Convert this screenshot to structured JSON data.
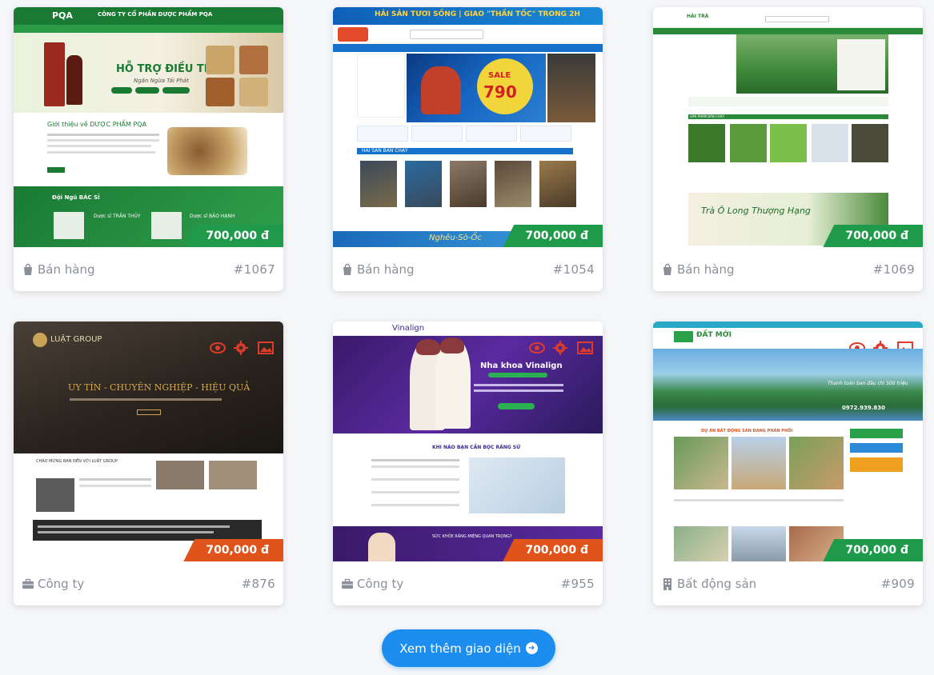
{
  "cards": [
    {
      "price": "700,000 đ",
      "category": "Bán hàng",
      "code": "#1067",
      "thumb": {
        "company": "CÔNG TY CỔ PHẦN DƯỢC PHẨM PQA",
        "brand": "PQA",
        "headline": "HỖ TRỢ ĐIỀU TRỊ",
        "sub": "Ngăn Ngừa Tái Phát",
        "intro": "Giới thiệu về DƯỢC PHẨM PQA",
        "team": "Đội Ngũ BÁC SĨ",
        "doctor1": "Dược sĩ TRẦN THỦY",
        "doctor2": "Dược sĩ BẢO HẠNH"
      }
    },
    {
      "price": "700,000 đ",
      "category": "Bán hàng",
      "code": "#1054",
      "thumb": {
        "banner": "HẢI SẢN TƯƠI SỐNG | GIAO \"THẦN TỐC\" TRONG 2H",
        "sale": "SALE",
        "sale_price": "790",
        "section": "HẢI SẢN BÁN CHẠY",
        "bottom": "Nghêu-Sò-Ốc"
      }
    },
    {
      "price": "700,000 đ",
      "category": "Bán hàng",
      "code": "#1069",
      "thumb": {
        "brand": "HẢI TRÀ",
        "section": "SẢN PHẨM BÁN CHẠY",
        "promo": "Trà Ô Long Thượng Hạng"
      }
    },
    {
      "price": "700,000 đ",
      "category": "Công ty",
      "code": "#876",
      "thumb": {
        "brand": "LUẬT GROUP",
        "headline": "UY TÍN - CHUYÊN NGHIỆP - HIỆU QUẢ",
        "welcome": "CHÀO MỪNG BẠN ĐẾN VỚI LUẬT GROUP"
      }
    },
    {
      "price": "700,000 đ",
      "category": "Công ty",
      "code": "#955",
      "thumb": {
        "brand": "Vinalign",
        "headline": "Nha khoa Vinalign",
        "question": "KHI NÀO BẠN CẦN BỌC RĂNG SỨ",
        "question2": "SỨC KHỎE RĂNG MIỆNG QUAN TRỌNG?"
      }
    },
    {
      "price": "700,000 đ",
      "category": "Bất động sản",
      "code": "#909",
      "thumb": {
        "brand": "ĐẤT MỚI",
        "tagline": "Thanh toán ban đầu chỉ 500 triệu",
        "phone": "0972.939.830",
        "section": "DỰ ÁN BẤT ĐỘNG SẢN ĐANG PHÂN PHỐI"
      }
    }
  ],
  "more_button": "Xem thêm giao diện",
  "colors": {
    "accent": "#1d8ef0",
    "price_green": "#1e9a4a",
    "price_orange": "#e0531a"
  }
}
